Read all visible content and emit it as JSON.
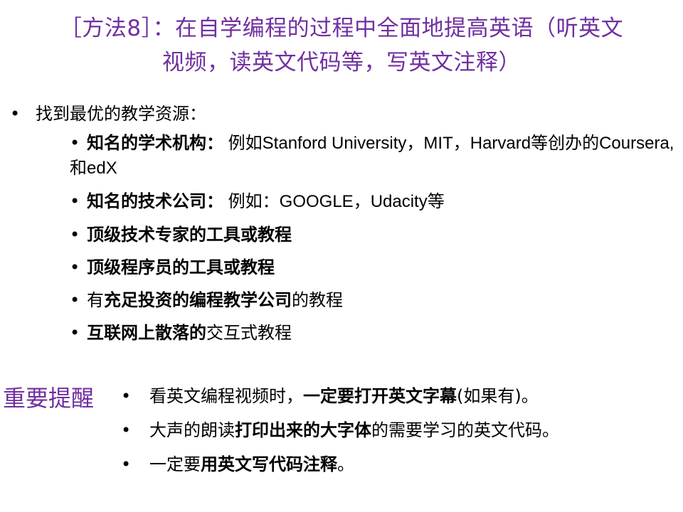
{
  "title": {
    "line1": "［方法8］：在自学编程的过程中全面地提高英语（听英文",
    "line2": "视频，读英文代码等，写英文注释）"
  },
  "main_bullet": {
    "marker": "•",
    "text": "找到最优的教学资源："
  },
  "sub_bullets": [
    {
      "marker": "•",
      "bold": "知名的学术机构：",
      "rest": " 例如Stanford University，MIT，Harvard等创办的Coursera, 和edX"
    },
    {
      "marker": "•",
      "bold": "知名的技术公司：",
      "rest": " 例如：GOOGLE，Udacity等"
    },
    {
      "marker": "•",
      "bold": "顶级技术专家的工具或教程",
      "rest": ""
    },
    {
      "marker": "•",
      "bold": "顶级程序员的工具或教程",
      "rest": ""
    },
    {
      "marker": "•",
      "pre": "有",
      "bold": "充足投资的编程教学公司",
      "rest": "的教程"
    },
    {
      "marker": "•",
      "bold": "互联网上散落的",
      "rest": "交互式教程"
    }
  ],
  "reminder": {
    "label": "重要提醒",
    "items": [
      {
        "marker": "•",
        "pre": "看英文编程视频时，",
        "bold": "一定要打开英文字幕",
        "rest": "(如果有)。"
      },
      {
        "marker": "•",
        "pre": "大声的朗读",
        "bold": "打印出来的大字体",
        "rest": "的需要学习的英文代码。"
      },
      {
        "marker": "•",
        "pre": "一定要",
        "bold": "用英文写代码注释",
        "rest": "。"
      }
    ]
  },
  "colors": {
    "accent": "#7030a0",
    "text": "#000000",
    "background": "#ffffff"
  }
}
